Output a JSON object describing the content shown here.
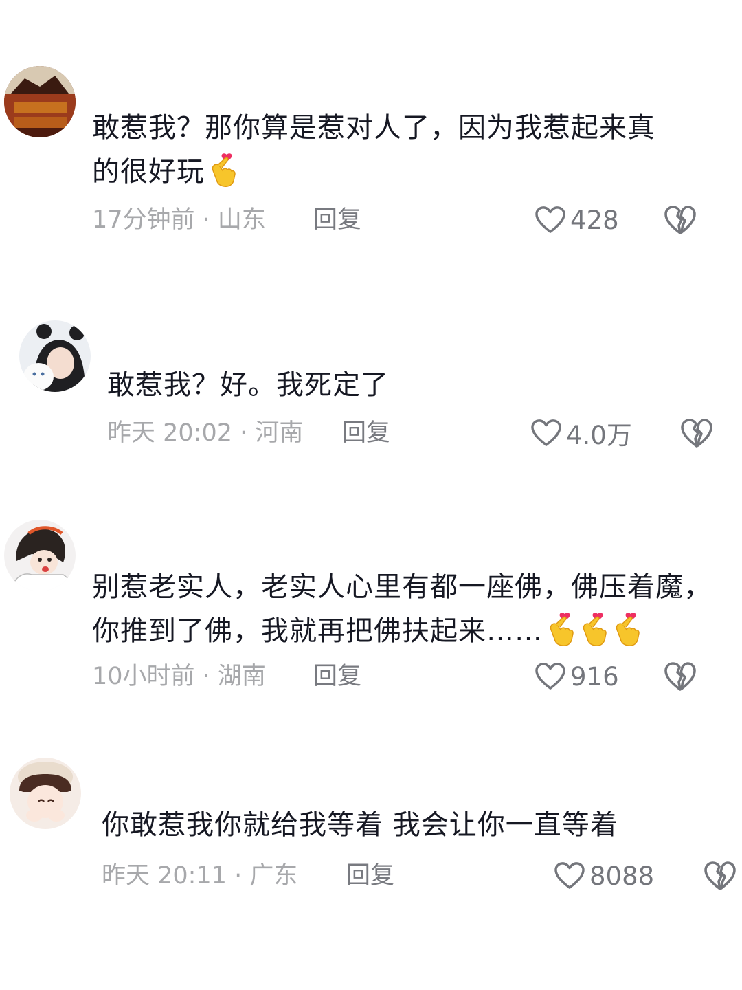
{
  "comments": [
    {
      "text_lines": [
        "敢惹我？那你算是惹对人了，因为我惹起来真",
        "的很好玩"
      ],
      "emoji": [
        "finger-heart"
      ],
      "meta": "17分钟前 · 山东",
      "reply": "回复",
      "likes": "428"
    },
    {
      "text_lines": [
        "敢惹我？好。我死定了"
      ],
      "emoji": [],
      "meta": "昨天 20:02 · 河南",
      "reply": "回复",
      "likes": "4.0万"
    },
    {
      "text_lines": [
        "别惹老实人，老实人心里有都一座佛，佛压着魔，",
        "你推到了佛，我就再把佛扶起来……"
      ],
      "emoji": [
        "finger-heart",
        "finger-heart",
        "finger-heart"
      ],
      "meta": "10小时前 · 湖南",
      "reply": "回复",
      "likes": "916"
    },
    {
      "text_lines": [
        "你敢惹我你就给我等着 我会让你一直等着"
      ],
      "emoji": [],
      "meta": "昨天 20:11 · 广东",
      "reply": "回复",
      "likes": "8088"
    }
  ],
  "icons": {
    "like": "heart-outline-icon",
    "dislike": "broken-heart-icon"
  },
  "colors": {
    "text": "#161823",
    "meta": "#a7a8ab",
    "reply": "#787a80",
    "icon": "#74767c"
  }
}
